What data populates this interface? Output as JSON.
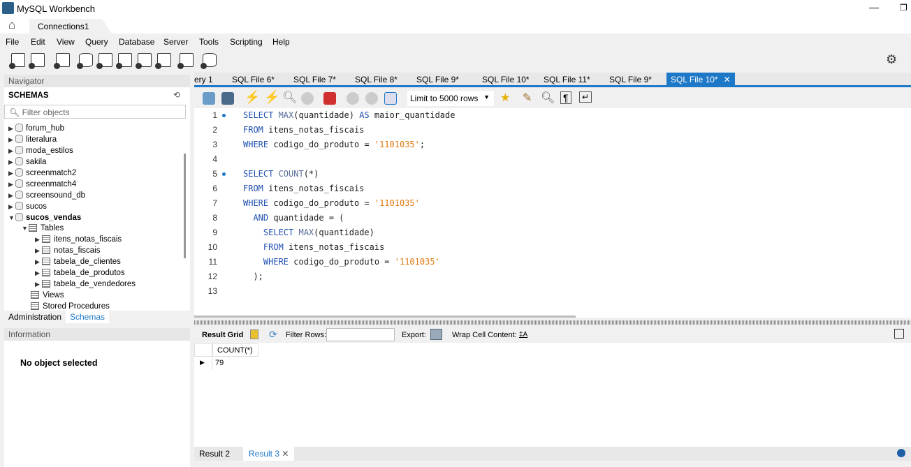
{
  "app": {
    "title": "MySQL Workbench",
    "connection_tab": "Connections1"
  },
  "menu": [
    "File",
    "Edit",
    "View",
    "Query",
    "Database",
    "Server",
    "Tools",
    "Scripting",
    "Help"
  ],
  "navigator": {
    "title": "Navigator",
    "schemas_label": "SCHEMAS",
    "filter_placeholder": "Filter objects",
    "schemas": [
      "forum_hub",
      "literalura",
      "moda_estilos",
      "sakila",
      "screenmatch2",
      "screenmatch4",
      "screensound_db",
      "sucos"
    ],
    "open_schema": "sucos_vendas",
    "tables_label": "Tables",
    "tables": [
      "itens_notas_fiscais",
      "notas_fiscais",
      "tabela_de_clientes",
      "tabela_de_produtos",
      "tabela_de_vendedores"
    ],
    "views_label": "Views",
    "procedures_label": "Stored Procedures",
    "tabs": [
      "Administration",
      "Schemas"
    ],
    "active_tab": "Schemas"
  },
  "information": {
    "title": "Information",
    "message": "No object selected"
  },
  "sql_tabs": [
    "ery 1",
    "SQL File 6*",
    "SQL File 7*",
    "SQL File 8*",
    "SQL File 9*",
    "SQL File 10*",
    "SQL File 11*",
    "SQL File 9*",
    "SQL File 10*"
  ],
  "active_sql_tab": "SQL File 10*",
  "editor_toolbar": {
    "limit": "Limit to 5000 rows"
  },
  "code": [
    [
      [
        "SELECT ",
        "kw"
      ],
      [
        "MAX",
        "fn"
      ],
      [
        "(quantidade) ",
        "pl"
      ],
      [
        "AS ",
        "kw"
      ],
      [
        "maior_quantidade",
        "pl"
      ]
    ],
    [
      [
        "FROM ",
        "kw"
      ],
      [
        "itens_notas_fiscais",
        "pl"
      ]
    ],
    [
      [
        "WHERE ",
        "kw"
      ],
      [
        "codigo_do_produto = ",
        "pl"
      ],
      [
        "'1101035'",
        "str"
      ],
      [
        ";",
        "pl"
      ]
    ],
    [],
    [
      [
        "SELECT ",
        "kw"
      ],
      [
        "COUNT",
        "fn"
      ],
      [
        "(*)",
        "pl"
      ]
    ],
    [
      [
        "FROM ",
        "kw"
      ],
      [
        "itens_notas_fiscais",
        "pl"
      ]
    ],
    [
      [
        "WHERE ",
        "kw"
      ],
      [
        "codigo_do_produto = ",
        "pl"
      ],
      [
        "'1101035'",
        "str"
      ]
    ],
    [
      [
        "  AND ",
        "kw"
      ],
      [
        "quantidade = (",
        "pl"
      ]
    ],
    [
      [
        "    SELECT ",
        "kw"
      ],
      [
        "MAX",
        "fn"
      ],
      [
        "(quantidade)",
        "pl"
      ]
    ],
    [
      [
        "    FROM ",
        "kw"
      ],
      [
        "itens_notas_fiscais",
        "pl"
      ]
    ],
    [
      [
        "    WHERE ",
        "kw"
      ],
      [
        "codigo_do_produto = ",
        "pl"
      ],
      [
        "'1101035'",
        "str"
      ]
    ],
    [
      [
        "  );",
        "pl"
      ]
    ],
    []
  ],
  "statement_markers": [
    1,
    5
  ],
  "result_toolbar": {
    "result_grid": "Result Grid",
    "filter_rows": "Filter Rows:",
    "export": "Export:",
    "wrap": "Wrap Cell Content:"
  },
  "result": {
    "columns": [
      "COUNT(*)"
    ],
    "rows": [
      [
        "79"
      ]
    ]
  },
  "result_tabs": [
    "Result 2",
    "Result 3"
  ],
  "active_result_tab": "Result 3",
  "colors": {
    "accent": "#1e78c8",
    "keyword": "#1f4fb0",
    "string": "#e07a10"
  }
}
